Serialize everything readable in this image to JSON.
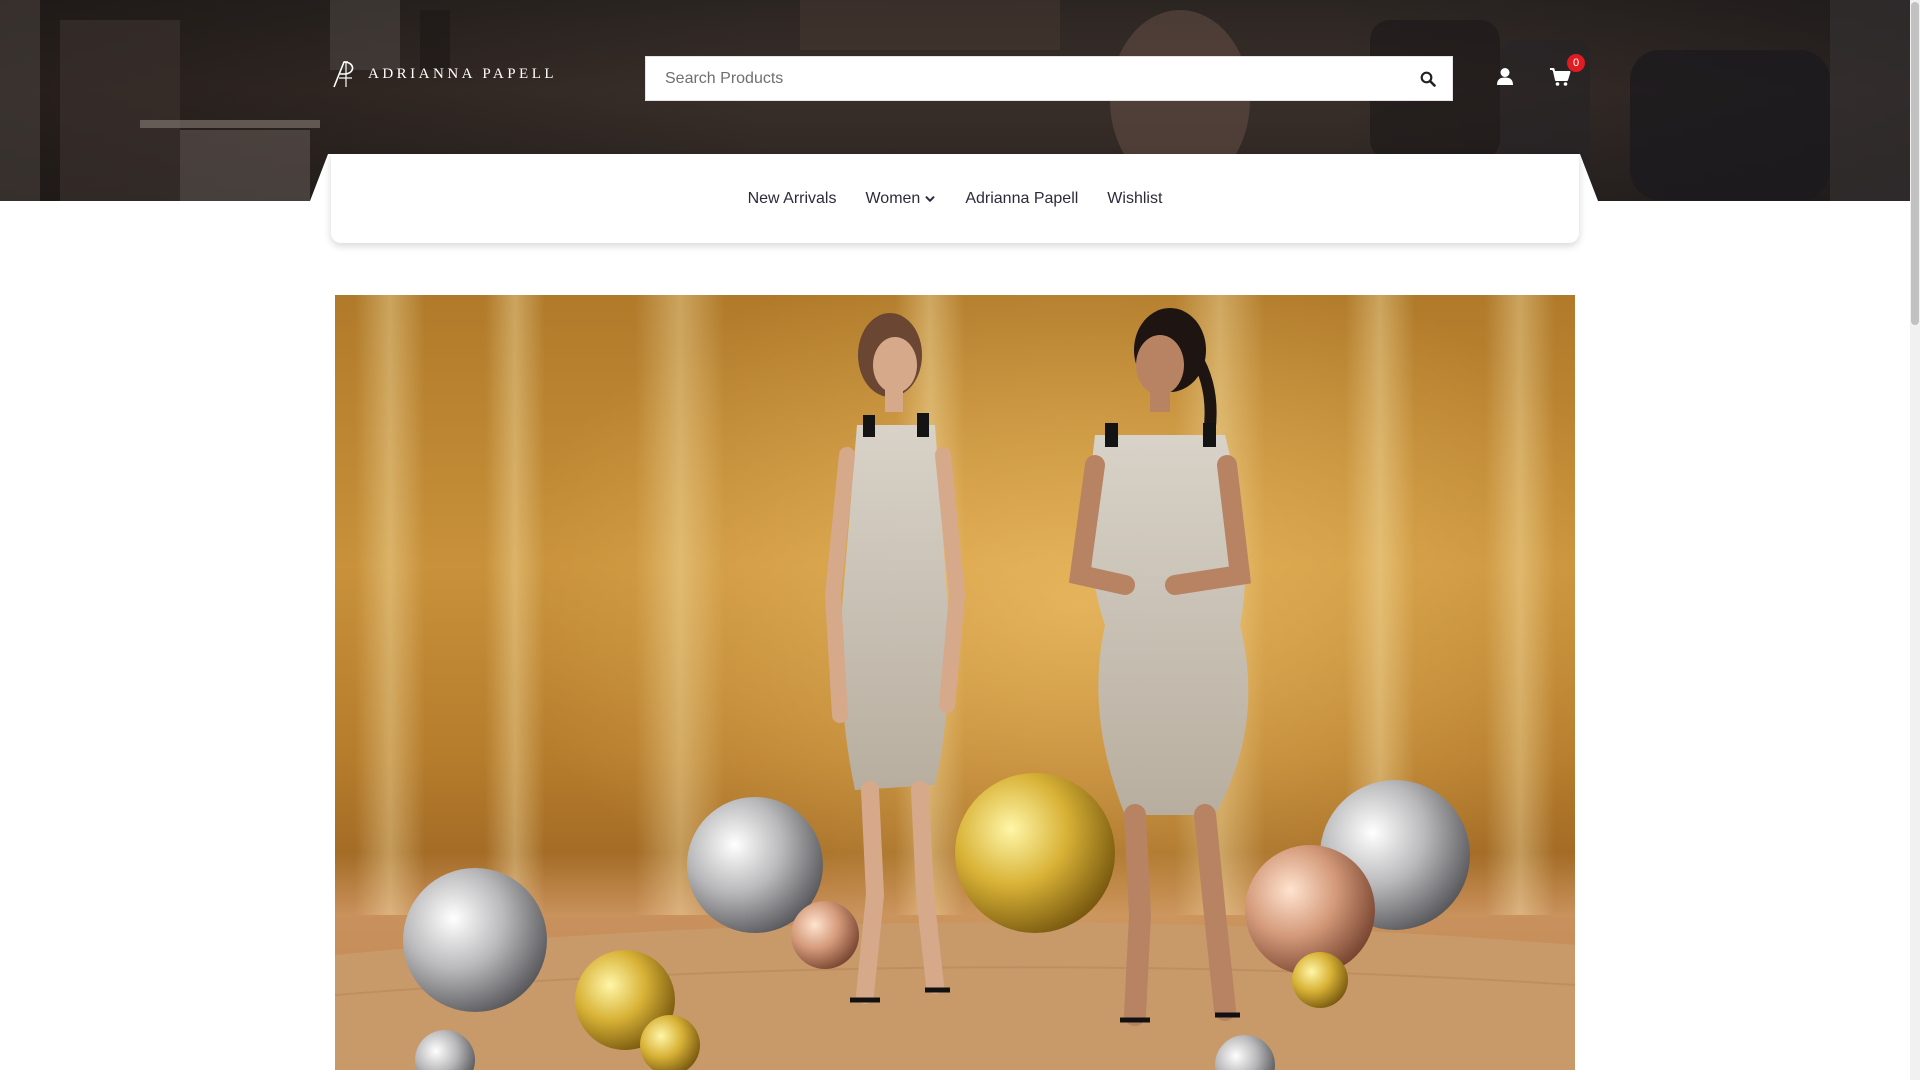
{
  "brand": {
    "name": "ADRIANNA PAPELL",
    "logo_icon": "ap-monogram-icon"
  },
  "search": {
    "placeholder": "Search Products",
    "value": "",
    "button_icon": "search-icon"
  },
  "header_actions": {
    "account_icon": "user-icon",
    "cart_icon": "cart-icon",
    "cart_count": "0"
  },
  "nav": {
    "items": [
      {
        "label": "New Arrivals",
        "has_dropdown": false
      },
      {
        "label": "Women",
        "has_dropdown": true
      },
      {
        "label": "Adrianna Papell",
        "has_dropdown": false
      },
      {
        "label": "Wishlist",
        "has_dropdown": false
      }
    ]
  },
  "hero": {
    "image": "two-women-in-sequin-dresses-with-disco-balls"
  },
  "colors": {
    "nav_text": "#2f2a3a",
    "badge": "#e01b22",
    "hero_gold": "#c8913a"
  }
}
